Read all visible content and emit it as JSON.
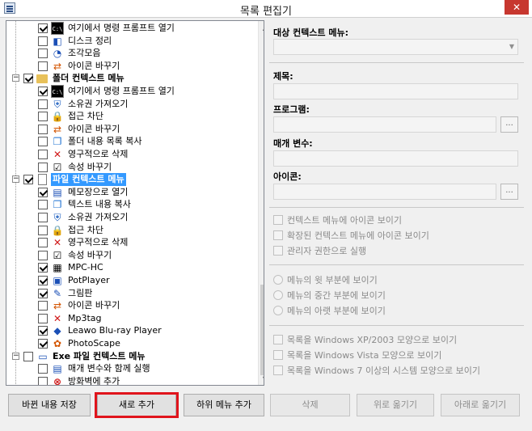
{
  "window": {
    "title": "목록 편집기",
    "close_glyph": "✕"
  },
  "tree": {
    "items": [
      {
        "kind": "command",
        "label": "여기에서 명령 프롬프트 열기",
        "checked": true,
        "icon": "cmd-icon",
        "glyph": "C:\\"
      },
      {
        "kind": "command",
        "label": "디스크 정리",
        "checked": false,
        "icon": "disk-cleanup-icon",
        "glyph": "◧"
      },
      {
        "kind": "command",
        "label": "조각모음",
        "checked": false,
        "icon": "defrag-icon",
        "glyph": "◔"
      },
      {
        "kind": "command",
        "label": "아이콘 바꾸기",
        "checked": false,
        "icon": "change-icon-icon",
        "glyph": "⇄"
      },
      {
        "kind": "category",
        "label": "폴더 컨텍스트 메뉴",
        "checked": true,
        "icon": "folder-icon",
        "glyph": ""
      },
      {
        "kind": "command",
        "label": "여기에서 명령 프롬프트 열기",
        "checked": true,
        "icon": "cmd-icon",
        "glyph": "C:\\"
      },
      {
        "kind": "command",
        "label": "소유권 가져오기",
        "checked": false,
        "icon": "shield-icon",
        "glyph": "⛨"
      },
      {
        "kind": "command",
        "label": "접근 차단",
        "checked": false,
        "icon": "lock-icon",
        "glyph": "🔒"
      },
      {
        "kind": "command",
        "label": "아이콘 바꾸기",
        "checked": false,
        "icon": "change-icon-icon",
        "glyph": "⇄"
      },
      {
        "kind": "command",
        "label": "폴더 내용 목록 복사",
        "checked": false,
        "icon": "copy-list-icon",
        "glyph": "❐"
      },
      {
        "kind": "command",
        "label": "영구적으로 삭제",
        "checked": false,
        "icon": "delete-icon",
        "glyph": "✕"
      },
      {
        "kind": "command",
        "label": "속성 바꾸기",
        "checked": false,
        "icon": "attributes-icon",
        "glyph": "☑"
      },
      {
        "kind": "category",
        "label": "파일 컨텍스트 메뉴",
        "checked": true,
        "icon": "file-icon",
        "glyph": "",
        "selected": true
      },
      {
        "kind": "command",
        "label": "메모장으로 열기",
        "checked": true,
        "icon": "notepad-icon",
        "glyph": "▤"
      },
      {
        "kind": "command",
        "label": "텍스트 내용 복사",
        "checked": false,
        "icon": "copy-text-icon",
        "glyph": "❐"
      },
      {
        "kind": "command",
        "label": "소유권 가져오기",
        "checked": false,
        "icon": "shield-icon",
        "glyph": "⛨"
      },
      {
        "kind": "command",
        "label": "접근 차단",
        "checked": false,
        "icon": "lock-icon",
        "glyph": "🔒"
      },
      {
        "kind": "command",
        "label": "영구적으로 삭제",
        "checked": false,
        "icon": "delete-icon",
        "glyph": "✕"
      },
      {
        "kind": "command",
        "label": "속성 바꾸기",
        "checked": false,
        "icon": "attributes-icon",
        "glyph": "☑"
      },
      {
        "kind": "command",
        "label": "MPC-HC",
        "checked": true,
        "icon": "mpc-hc-icon",
        "glyph": "▦"
      },
      {
        "kind": "command",
        "label": "PotPlayer",
        "checked": true,
        "icon": "potplayer-icon",
        "glyph": "▣"
      },
      {
        "kind": "command",
        "label": "그림판",
        "checked": true,
        "icon": "paint-icon",
        "glyph": "✎"
      },
      {
        "kind": "command",
        "label": "아이콘 바꾸기",
        "checked": false,
        "icon": "change-icon-icon",
        "glyph": "⇄"
      },
      {
        "kind": "command",
        "label": "Mp3tag",
        "checked": false,
        "icon": "mp3tag-icon",
        "glyph": "✕"
      },
      {
        "kind": "command",
        "label": "Leawo Blu-ray Player",
        "checked": true,
        "icon": "leawo-icon",
        "glyph": "◆"
      },
      {
        "kind": "command",
        "label": "PhotoScape",
        "checked": true,
        "icon": "photoscape-icon",
        "glyph": "✿"
      },
      {
        "kind": "category",
        "label": "Exe 파일 컨텍스트 메뉴",
        "checked": false,
        "icon": "exe-window-icon",
        "glyph": "▭"
      },
      {
        "kind": "command",
        "label": "매개 변수와 함께 실행",
        "checked": false,
        "icon": "run-params-icon",
        "glyph": "▤"
      },
      {
        "kind": "command",
        "label": "방화벽에 추가",
        "checked": false,
        "icon": "firewall-icon",
        "glyph": "⊗"
      }
    ]
  },
  "scrollbar": {
    "up": "▲",
    "down": "▼"
  },
  "form": {
    "target_menu_label": "대상 컨텍스트 메뉴:",
    "target_menu_value": "",
    "dropdown_glyph": "▼",
    "title_label": "제목:",
    "title_value": "",
    "program_label": "프로그램:",
    "program_value": "",
    "browse_label": "...",
    "params_label": "매개 변수:",
    "params_value": "",
    "icon_label": "아이콘:",
    "icon_value": ""
  },
  "options": {
    "show_icon": "컨텍스트 메뉴에 아이콘 보이기",
    "show_icon_extended": "확장된 컨텍스트 메뉴에 아이콘 보이기",
    "run_as_admin": "관리자 권한으로 실행",
    "pos_top": "메뉴의 윗 부분에 보이기",
    "pos_middle": "메뉴의 중간 부분에 보이기",
    "pos_bottom": "메뉴의 아랫 부분에 보이기",
    "style_xp": "목록을 Windows XP/2003 모양으로 보이기",
    "style_vista": "목록을 Windows Vista 모양으로 보이기",
    "style_win7": "목록을 Windows 7 이상의 시스템 모양으로 보이기"
  },
  "buttons": {
    "save": "바뀐 내용 저장",
    "add_new": "새로 추가",
    "add_submenu": "하위 메뉴 추가",
    "delete": "삭제",
    "move_up": "위로 옮기기",
    "move_down": "아래로 옮기기"
  },
  "colors": {
    "selection": "#3399ff",
    "highlight_box": "#e0141c",
    "close": "#c7372f"
  }
}
